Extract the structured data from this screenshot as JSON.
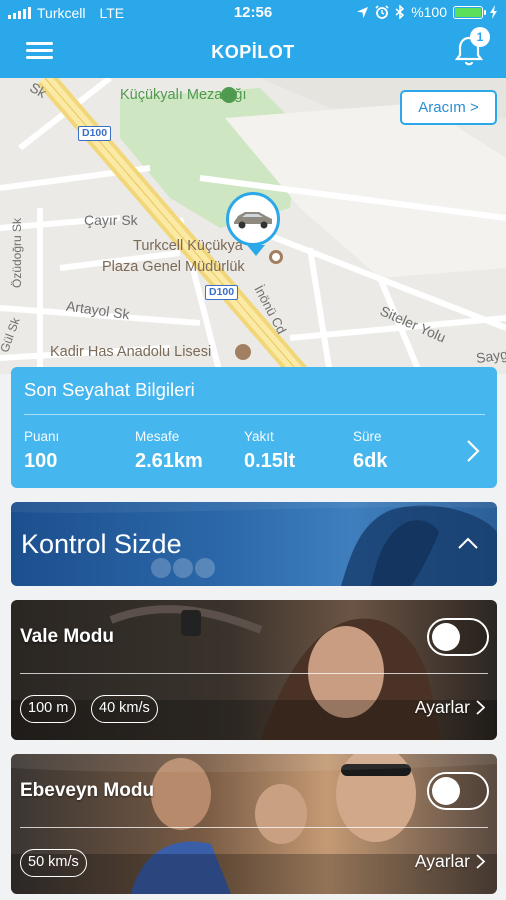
{
  "status_bar": {
    "carrier": "Turkcell",
    "network": "LTE",
    "time": "12:56",
    "battery_text": "%100",
    "battery_level": 1.0,
    "battery_color": "#5ce05c"
  },
  "header": {
    "title": "KOPİLOT",
    "notification_count": "1",
    "background": "#2aa8e9"
  },
  "map": {
    "aracim_button": "Aracım >",
    "labels": {
      "cemetery": "Küçükyalı Mezarlığı",
      "street_sk_top": "Sk",
      "d100_top": "D100",
      "cayir": "Çayır Sk",
      "turkcell_1": "Turkcell Küçükya",
      "turkcell_2": "Plaza Genel Müdürlük",
      "d100_mid": "D100",
      "ozudogru": "Özüdoğru Sk",
      "gul": "Gül Sk",
      "artayol": "Artayol Sk",
      "inonu": "İnönü Cd",
      "siteler": "Siteler Yolu",
      "sayg": "Sayg",
      "kadir_has": "Kadir Has Anadolu Lisesi"
    }
  },
  "last_trip": {
    "title": "Son Seyahat Bilgileri",
    "stats": [
      {
        "label": "Puanı",
        "value": "100"
      },
      {
        "label": "Mesafe",
        "value": "2.61km"
      },
      {
        "label": "Yakıt",
        "value": "0.15lt"
      },
      {
        "label": "Süre",
        "value": "6dk"
      }
    ]
  },
  "control": {
    "title": "Kontrol Sizde"
  },
  "modes": [
    {
      "name": "Vale Modu",
      "enabled": false,
      "pills": [
        "100 m",
        "40 km/s"
      ],
      "settings_label": "Ayarlar"
    },
    {
      "name": "Ebeveyn Modu",
      "enabled": false,
      "pills": [
        "50 km/s"
      ],
      "settings_label": "Ayarlar"
    }
  ],
  "colors": {
    "accent": "#2aa8e9",
    "trip_card": "#45b6ee"
  }
}
